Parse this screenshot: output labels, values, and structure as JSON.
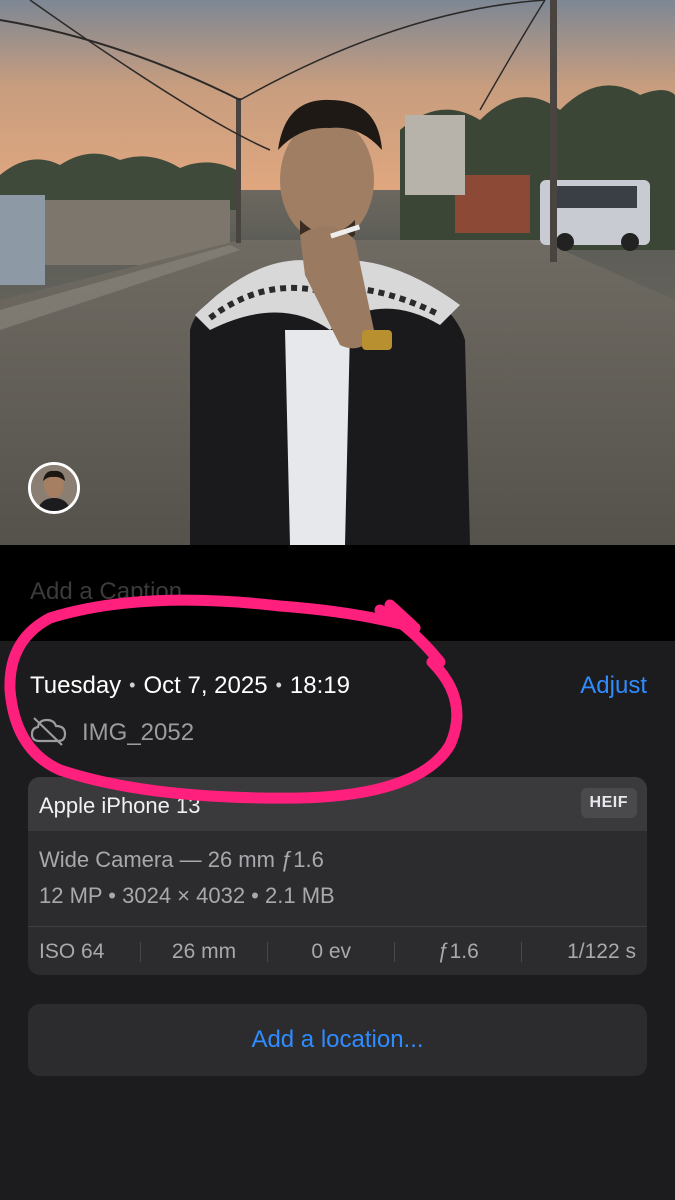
{
  "caption": {
    "placeholder": "Add a Caption"
  },
  "info": {
    "day": "Tuesday",
    "date": "Oct 7, 2025",
    "time": "18:19",
    "separator": "•",
    "adjust_label": "Adjust",
    "filename": "IMG_2052",
    "cloud_icon": "cloud-slash-icon"
  },
  "device": {
    "name": "Apple iPhone 13",
    "format_badge": "HEIF",
    "lens": "Wide Camera — 26 mm ƒ1.6",
    "specs": "12 MP • 3024 × 4032 • 2.1 MB"
  },
  "exif": {
    "iso": "ISO 64",
    "focal": "26 mm",
    "ev": "0 ev",
    "aperture": "ƒ1.6",
    "shutter": "1/122 s"
  },
  "location": {
    "label": "Add a location..."
  },
  "colors": {
    "accent": "#2e8cff",
    "annotation": "#ff1f7d",
    "panel": "#1c1c1e"
  }
}
